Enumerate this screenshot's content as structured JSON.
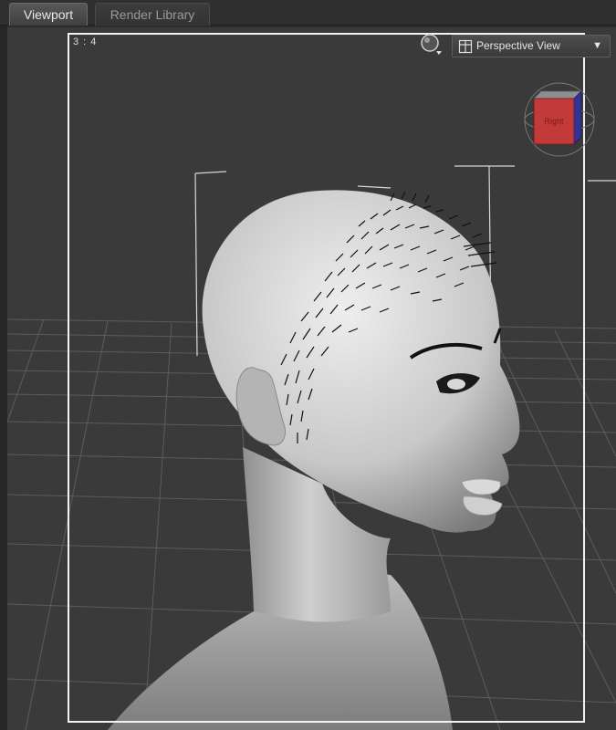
{
  "tabs": [
    {
      "label": "Viewport",
      "active": true
    },
    {
      "label": "Render Library",
      "active": false
    }
  ],
  "viewport": {
    "aspect_ratio": "3 : 4",
    "view_selector": {
      "selected": "Perspective View",
      "arrow": "▼"
    },
    "view_cube": {
      "face_label": "Right"
    }
  },
  "colors": {
    "background": "#3a3a3a",
    "frame": "#f2f2f2",
    "cube_right": "#c23a3a",
    "cube_back": "#33339a",
    "grid": "#5a5a5a"
  }
}
